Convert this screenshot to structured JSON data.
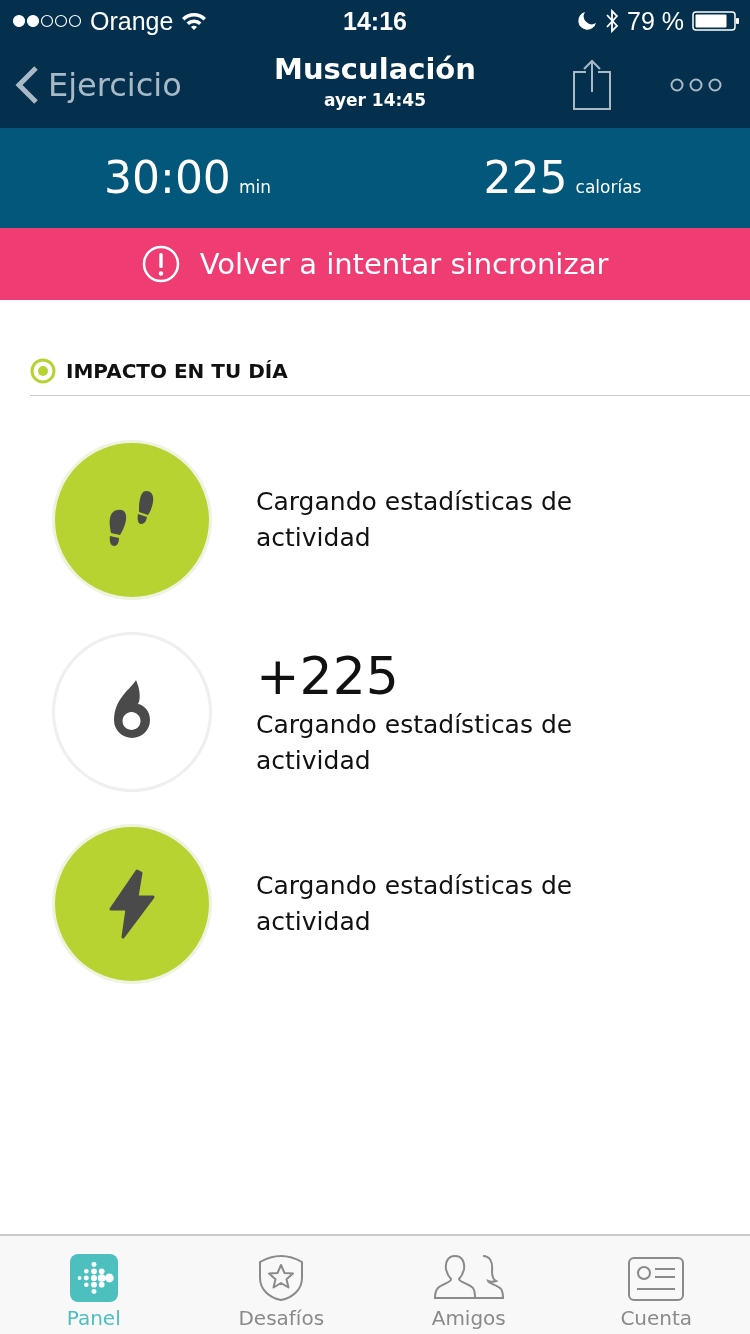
{
  "status_bar": {
    "carrier": "Orange",
    "time": "14:16",
    "battery": "79 %"
  },
  "nav": {
    "back": "Ejercicio",
    "title": "Musculación",
    "subtitle": "ayer 14:45"
  },
  "stats": [
    {
      "value": "30:00",
      "unit": "min"
    },
    {
      "value": "225",
      "unit": "calorías"
    }
  ],
  "banner": {
    "text": "Volver a intentar sincronizar"
  },
  "section": {
    "title": "IMPACTO EN TU DÍA"
  },
  "items": [
    {
      "kind": "steps",
      "filled": true,
      "lines": [
        "Cargando estadísticas de",
        "actividad"
      ]
    },
    {
      "kind": "calories",
      "filled": false,
      "value": "+225",
      "lines": [
        "Cargando estadísticas de",
        "actividad"
      ]
    },
    {
      "kind": "energy",
      "filled": true,
      "lines": [
        "Cargando estadísticas de",
        "actividad"
      ]
    }
  ],
  "tabs": [
    {
      "kind": "panel",
      "label": "Panel",
      "selected": true
    },
    {
      "kind": "challenges",
      "label": "Desafíos",
      "selected": false
    },
    {
      "kind": "friends",
      "label": "Amigos",
      "selected": false
    },
    {
      "kind": "account",
      "label": "Cuenta",
      "selected": false
    }
  ]
}
